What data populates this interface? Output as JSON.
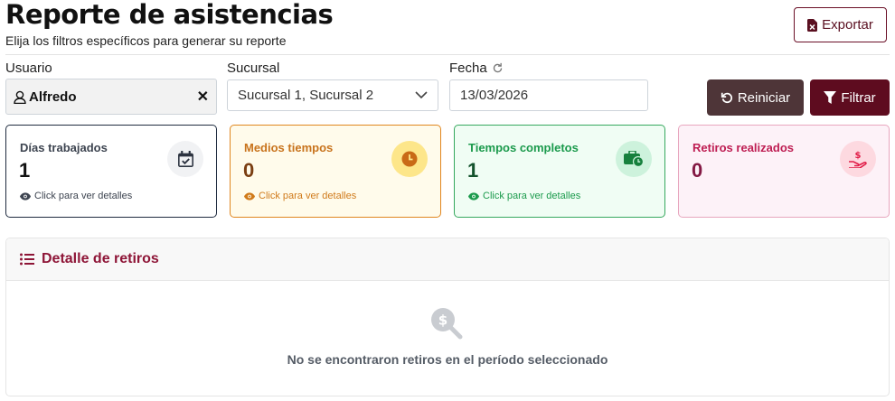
{
  "header": {
    "title": "Reporte de asistencias",
    "subtitle": "Elija los filtros específicos para generar su reporte",
    "export_label": "Exportar"
  },
  "filters": {
    "user_label": "Usuario",
    "user_value": "Alfredo",
    "branch_label": "Sucursal",
    "branch_value": "Sucursal 1, Sucursal 2",
    "date_label": "Fecha",
    "date_value": "13/03/2026",
    "reset_label": "Reiniciar",
    "filter_label": "Filtrar"
  },
  "cards": [
    {
      "title": "Días trabajados",
      "value": "1",
      "link": "Click para ver detalles",
      "icon": "calendar-check-icon"
    },
    {
      "title": "Medios tiempos",
      "value": "0",
      "link": "Click para ver detalles",
      "icon": "clock-icon"
    },
    {
      "title": "Tiempos completos",
      "value": "1",
      "link": "Click para ver detalles",
      "icon": "briefcase-clock-icon"
    },
    {
      "title": "Retiros realizados",
      "value": "0",
      "icon": "hand-dollar-icon"
    }
  ],
  "withdrawals": {
    "title": "Detalle de retiros",
    "empty_message": "No se encontraron retiros en el período seleccionado"
  },
  "colors": {
    "primary": "#5e0c1f",
    "reset_button": "#4e3538",
    "orange": "#e0861e",
    "green": "#1b9a4c",
    "pink": "#be1d52"
  }
}
